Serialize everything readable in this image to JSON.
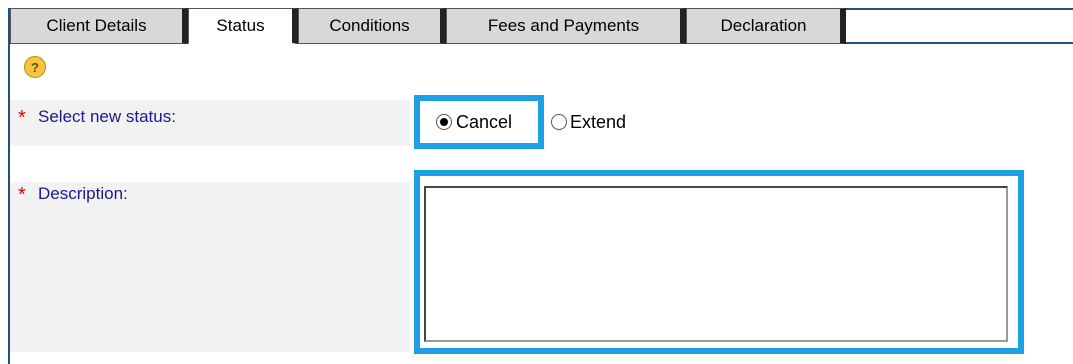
{
  "tabs": [
    {
      "label": "Client Details",
      "active": false
    },
    {
      "label": "Status",
      "active": true
    },
    {
      "label": "Conditions",
      "active": false
    },
    {
      "label": "Fees and Payments",
      "active": false
    },
    {
      "label": "Declaration",
      "active": false
    }
  ],
  "help_icon": "?",
  "form": {
    "status": {
      "required_marker": "*",
      "label": "Select new status:",
      "options": [
        {
          "label": "Cancel",
          "checked": true
        },
        {
          "label": "Extend",
          "checked": false
        }
      ]
    },
    "description": {
      "required_marker": "*",
      "label": "Description:",
      "value": ""
    }
  },
  "colors": {
    "highlight": "#1da1e6",
    "label": "#1a1a8c",
    "required": "#e00000",
    "frame": "#1f4f86"
  }
}
